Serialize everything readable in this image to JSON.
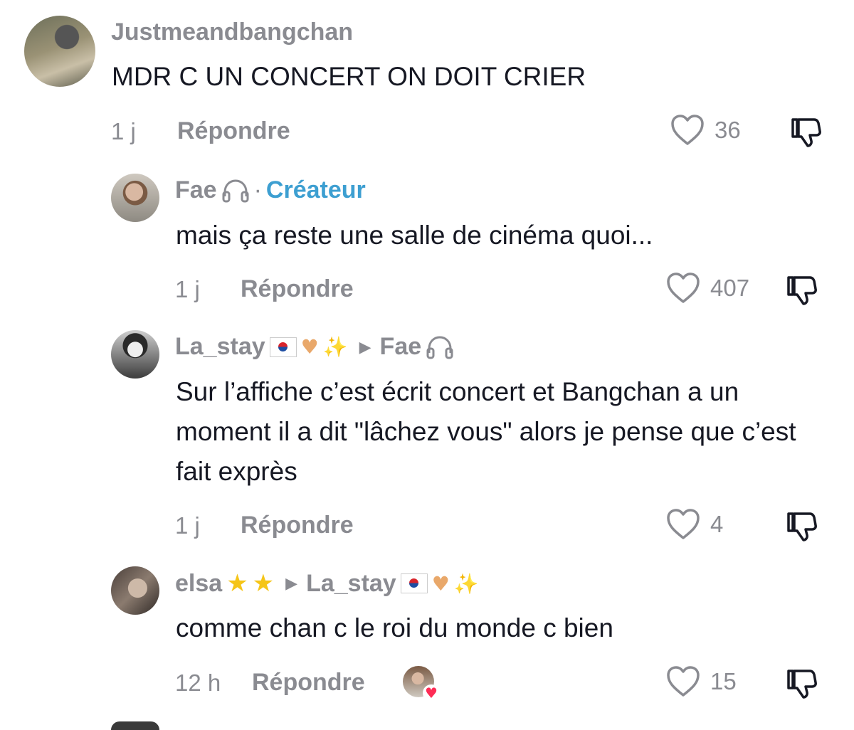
{
  "comments": [
    {
      "username": "Justmeandbangchan",
      "text": "MDR C UN CONCERT ON DOIT CRIER",
      "time": "1 j",
      "reply_label": "Répondre",
      "likes": "36"
    },
    {
      "username": "Fae",
      "creator_label": "Créateur",
      "separator": "·",
      "text": "mais ça reste une salle de cinéma quoi...",
      "time": "1 j",
      "reply_label": "Répondre",
      "likes": "407"
    },
    {
      "username": "La_stay",
      "reply_to": "Fae",
      "text": "Sur l’affiche c’est écrit concert et Bangchan a un moment il a dit \"lâchez vous\" alors je pense que c’est fait exprès",
      "time": "1 j",
      "reply_label": "Répondre",
      "likes": "4"
    },
    {
      "username": "elsa",
      "reply_to": "La_stay",
      "text": "comme chan c le roi du monde c bien",
      "time": "12 h",
      "reply_label": "Répondre",
      "likes": "15"
    }
  ],
  "colors": {
    "text": "#161823",
    "muted": "#8a8b91",
    "creator": "#3d9fd1",
    "heart_badge": "#fe2c55"
  },
  "icons": [
    "heart-icon",
    "dislike-icon",
    "headphones-icon",
    "star-icon",
    "sparkles-icon",
    "heart-hands-icon",
    "korea-flag-icon"
  ]
}
